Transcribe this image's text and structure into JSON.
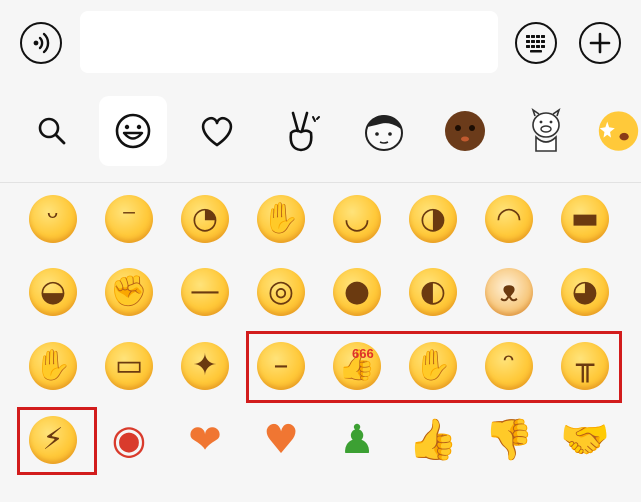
{
  "input": {
    "value": "",
    "placeholder": ""
  },
  "colors": {
    "background": "#f6f6f6",
    "input_bg": "#ffffff",
    "highlight": "#d21c1c",
    "emoji_yellow": "#ffc93a"
  },
  "icons": {
    "voice": "voice-message-icon",
    "keyboard": "keyboard-icon",
    "plus": "plus-icon"
  },
  "tabs": [
    {
      "name": "search-icon",
      "active": false
    },
    {
      "name": "smiley-icon",
      "active": true
    },
    {
      "name": "heart-icon",
      "active": false
    },
    {
      "name": "victory-hand-icon",
      "active": false
    },
    {
      "name": "sticker-face-icon",
      "active": false
    },
    {
      "name": "brown-face-icon",
      "active": false
    },
    {
      "name": "pig-sticker-icon",
      "active": false
    },
    {
      "name": "emoji-partial-icon",
      "active": false
    }
  ],
  "grid": {
    "rows": [
      [
        "pensive-face",
        "unamused-face",
        "thinking-face",
        "facepalm-crying-face",
        "smirk-face",
        "side-eye-face",
        "blush-face",
        "grin-face"
      ],
      [
        "watermelon-face",
        "struggle-face",
        "sweat-face",
        "shocked-face",
        "yawn-face",
        "smug-face",
        "doge-face",
        "sly-face"
      ],
      [
        "blush-hand-face",
        "mask-headband-face",
        "star-eyes-face",
        "emotionless-face",
        "666-face",
        "salute-face",
        "sigh-face",
        "crying-face"
      ],
      [
        "cracked-face",
        "lips",
        "heart",
        "broken-heart",
        "green-man",
        "thumbs-up",
        "thumbs-down",
        "handshake"
      ]
    ],
    "label_666": "666"
  }
}
